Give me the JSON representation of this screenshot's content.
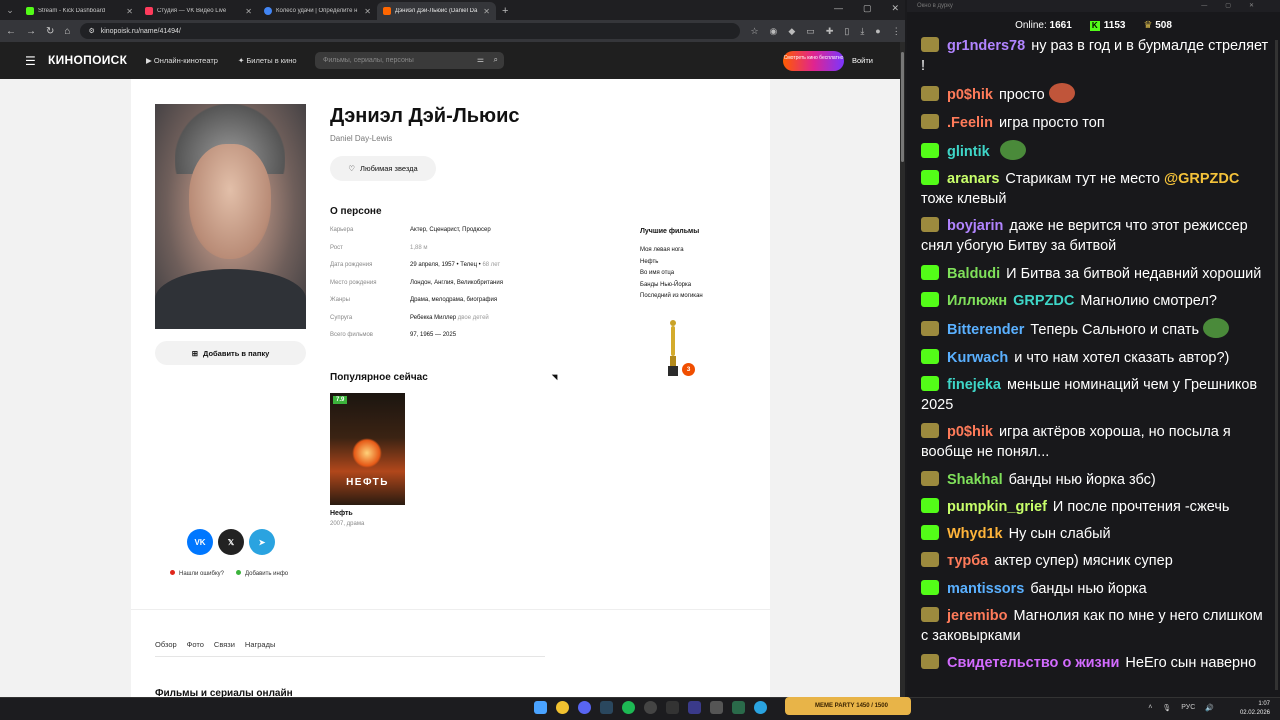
{
  "browser": {
    "tabs": [
      {
        "title": "Stream - Kick Dashboard",
        "color": "#53fc18",
        "active": false
      },
      {
        "title": "Студия — VK Видео Live",
        "color": "#ff3b5c",
        "active": false
      },
      {
        "title": "Колесо удачи | Определите н",
        "color": "#4285f4",
        "active": false
      },
      {
        "title": "Дэниэл Дэй-Льюис (Daniel Da",
        "color": "#ff6600",
        "active": true
      }
    ],
    "url": "kinopoisk.ru/name/41494/"
  },
  "kp": {
    "logo": "КИНОПОИСК",
    "nav_online": "Онлайн-кинотеатр",
    "nav_tickets": "Билеты в кино",
    "search_placeholder": "Фильмы, сериалы, персоны",
    "promo": "Смотреть кино бесплатно",
    "login": "Войти"
  },
  "person": {
    "name": "Дэниэл Дэй-Льюис",
    "original_name": "Daniel Day-Lewis",
    "fav_button": "Любимая звезда",
    "add_folder": "Добавить в папку",
    "about_title": "О персоне",
    "facts": [
      {
        "k": "Карьера",
        "v": "Актер, Сценарист, Продюсер",
        "extra": ""
      },
      {
        "k": "Рост",
        "v": "1,88 м",
        "extra": ""
      },
      {
        "k": "Дата рождения",
        "v": "29 апреля, 1957 • Телец •",
        "extra": "68 лет"
      },
      {
        "k": "Место рождения",
        "v": "Лондон, Англия, Великобритания",
        "extra": ""
      },
      {
        "k": "Жанры",
        "v": "Драма, мелодрама, биография",
        "extra": ""
      },
      {
        "k": "Супруга",
        "v": "Ребекка Миллер",
        "extra": "двое детей"
      },
      {
        "k": "Всего фильмов",
        "v": "97, 1965 — 2025",
        "extra": ""
      }
    ],
    "best_title": "Лучшие фильмы",
    "best_films": [
      "Моя левая нога",
      "Нефть",
      "Во имя отца",
      "Банды Нью-Йорка",
      "Последний из могикан"
    ],
    "oscar_count": "3",
    "popular_title": "Популярное сейчас",
    "popular_movie": {
      "title": "Нефть",
      "poster_text": "НЕФТЬ",
      "meta": "2007, драма",
      "rating": "7.9"
    },
    "share": [
      "VK",
      "𝕏",
      "➤"
    ],
    "feedback_error": "Нашли ошибку?",
    "feedback_add": "Добавить инфо",
    "subnav": [
      "Обзор",
      "Фото",
      "Связи",
      "Награды"
    ],
    "next_section": "Фильмы и сериалы онлайн"
  },
  "chat": {
    "window_title": "Окно в дуркy",
    "online_label": "Online:",
    "online_count": "1661",
    "kick_count": "1153",
    "other_count": "508",
    "messages": [
      {
        "badge": "h",
        "user": "gr1nders78",
        "color": "#b184ff",
        "text": "ну раз в год и в бурмалде стреляет  !",
        "emote": ""
      },
      {
        "badge": "h",
        "user": "p0$hik",
        "color": "#ff7b5a",
        "text": "просто",
        "emote": "#c0553a"
      },
      {
        "badge": "h",
        "user": ".Feelin",
        "color": "#ff7b5a",
        "text": "игра просто топ",
        "emote": ""
      },
      {
        "badge": "k",
        "user": "glintik",
        "color": "#3ed6c8",
        "text": "",
        "emote": "#4a8a3a"
      },
      {
        "badge": "k",
        "user": "aranars",
        "color": "#c8ff6a",
        "text": "Старикам тут не место",
        "mention": "@GRPZDC",
        "tail": "тоже клевый",
        "emote": ""
      },
      {
        "badge": "h",
        "user": "boyjarin",
        "color": "#b184ff",
        "text": "даже не верится что этот режиссер снял убогую Битву за битвой",
        "emote": ""
      },
      {
        "badge": "k",
        "user": "Baldudi",
        "color": "#7fe05a",
        "text": "И Битва за битвой недавний хороший",
        "emote": ""
      },
      {
        "badge": "k",
        "user": "Иллюжн",
        "color": "#7fe05a",
        "text": "Магнолию смотрел?",
        "prefix": "GRPZDC",
        "emote": ""
      },
      {
        "badge": "h",
        "user": "Bitterender",
        "color": "#5ab0ff",
        "text": "Теперь Сального и спать",
        "emote": "#4a8a3a"
      },
      {
        "badge": "k",
        "user": "Kurwach",
        "color": "#5ab0ff",
        "text": "и что нам хотел сказать автор?)",
        "emote": ""
      },
      {
        "badge": "k",
        "user": "finejeka",
        "color": "#3ed6c8",
        "text": "меньше номинаций чем у Грешников 2025",
        "emote": ""
      },
      {
        "badge": "h",
        "user": "p0$hik",
        "color": "#ff7b5a",
        "text": "игра актёров хороша, но посыла я вообще не понял...",
        "emote": ""
      },
      {
        "badge": "h",
        "user": "Shakhal",
        "color": "#7fe05a",
        "text": "банды нью йорка збс)",
        "emote": ""
      },
      {
        "badge": "k",
        "user": "pumpkin_grief",
        "color": "#c8ff6a",
        "text": "И после прочтения -сжечь",
        "emote": ""
      },
      {
        "badge": "k",
        "user": "Whyd1k",
        "color": "#ffb43a",
        "text": "Ну сын слабый",
        "emote": ""
      },
      {
        "badge": "h",
        "user": "турба",
        "color": "#ff7b5a",
        "text": "актер супер) мясник супер",
        "emote": ""
      },
      {
        "badge": "k",
        "user": "mantissors",
        "color": "#5ab0ff",
        "text": "банды нью йорка",
        "emote": ""
      },
      {
        "badge": "h",
        "user": "jeremibo",
        "color": "#ff7b5a",
        "text": "Магнолия как по мне у него слишком с заковырками",
        "emote": ""
      },
      {
        "badge": "h",
        "user": "Свидетельство о жизни",
        "color": "#d36bff",
        "text": "НеЕго сын наверно",
        "emote": ""
      }
    ]
  },
  "taskbar": {
    "meme": "MEME PARTY",
    "meme_progress": "1450 / 1500",
    "lang": "РУС",
    "time": "1:07",
    "date": "02.02.2026"
  }
}
